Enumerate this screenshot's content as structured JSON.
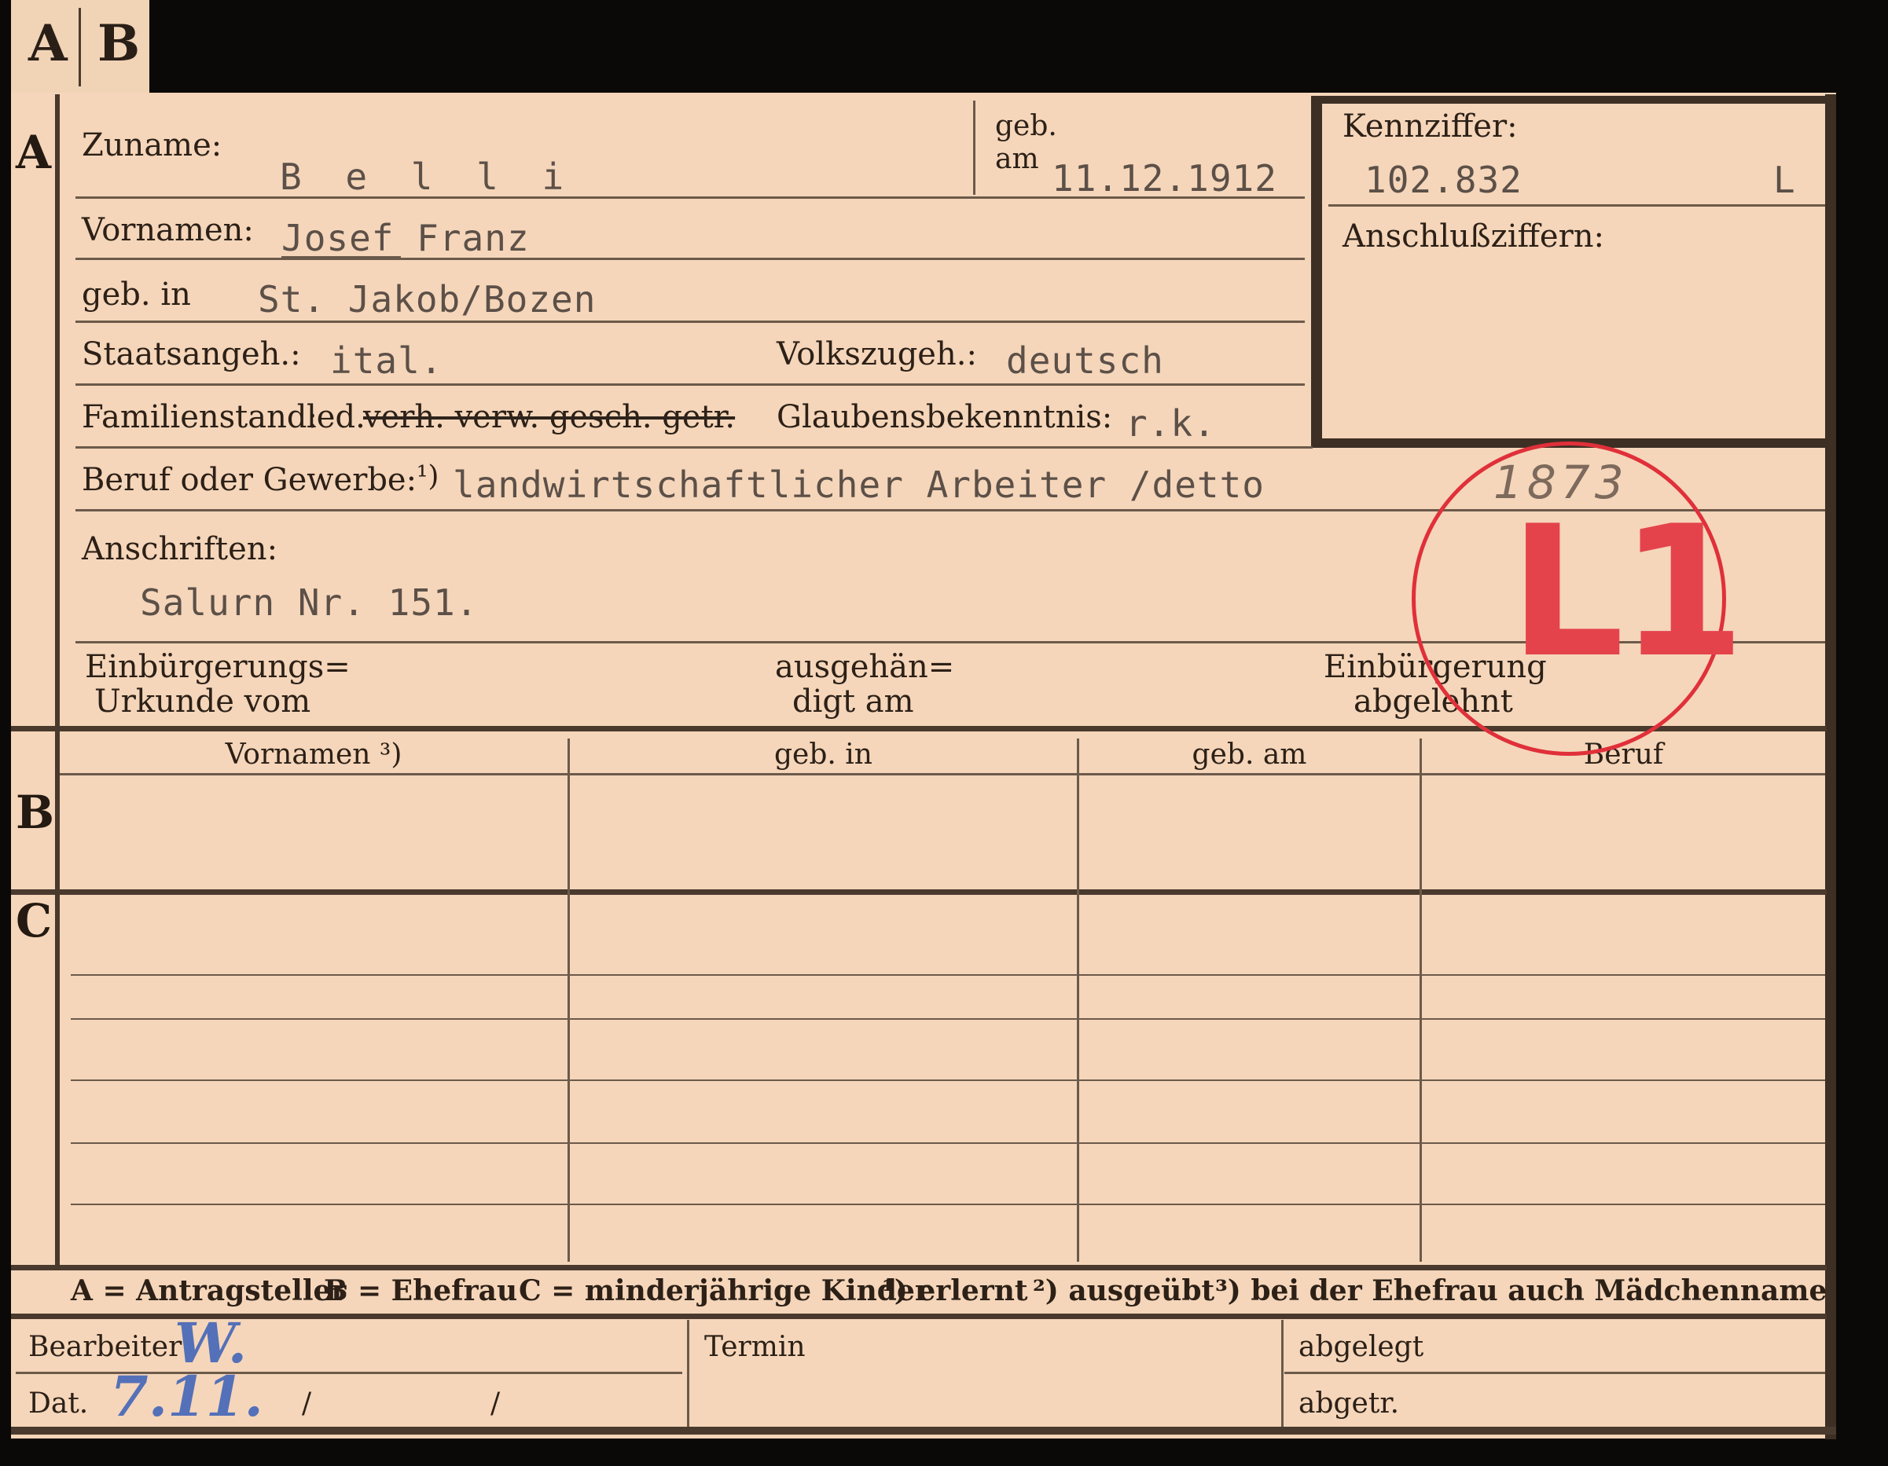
{
  "tab": {
    "letter_a": "A",
    "letter_b": "B"
  },
  "section_markers": {
    "a": "A",
    "b": "B",
    "c": "C"
  },
  "labels": {
    "zuname": "Zuname:",
    "geb_am_1": "geb.",
    "geb_am_2": "am",
    "kennziffer": "Kennziffer:",
    "anschlussziffern": "Anschlußziffern:",
    "vornamen": "Vornamen:",
    "geb_in": "geb. in",
    "staatsangeh": "Staatsangeh.:",
    "volkszugeh": "Volkszugeh.:",
    "familienstand": "Familienstand:",
    "familienstand_led": "led.",
    "familienstand_struck": "verh. verw. gesch. getr.",
    "glaubensbekenntnis": "Glaubensbekenntnis:",
    "beruf": "Beruf oder Gewerbe:",
    "beruf_note": "¹)",
    "anschriften": "Anschriften:",
    "einbuergerung_1": "Einbürgerungs=",
    "einbuergerung_2": "Urkunde vom",
    "ausgehaendigt_1": "ausgehän=",
    "ausgehaendigt_2": "digt am",
    "abgelehnt_1": "Einbürgerung",
    "abgelehnt_2": "abgelehnt"
  },
  "values": {
    "zuname": "B e l l i",
    "geb_am": "11.12.1912",
    "kennziffer": "102.832",
    "kennziffer_suffix": "L",
    "vornamen": "Josef Franz",
    "geb_in": "St. Jakob/Bozen",
    "staatsangeh": "ital.",
    "volkszugeh": "deutsch",
    "glaubensbekenntnis": "r.k.",
    "beruf": "landwirtschaftlicher Arbeiter /detto",
    "anschrift": "Salurn Nr. 151."
  },
  "table": {
    "columns": [
      "Vornamen ³)",
      "geb. in",
      "geb. am",
      "Beruf"
    ]
  },
  "legend": {
    "a": "A = Antragsteller",
    "b": "B = Ehefrau",
    "c": "C = minderjährige Kinder",
    "n1": "¹) erlernt",
    "n2": "²) ausgeübt",
    "n3": "³) bei der Ehefrau auch Mädchenname"
  },
  "footer": {
    "bearbeiter": "Bearbeiter:",
    "dat": "Dat.",
    "termin": "Termin",
    "abgelegt": "abgelegt",
    "abgetr": "abgetr.",
    "slash1": "/",
    "slash2": "/"
  },
  "handwriting": {
    "signature": "W.",
    "date": "7.11."
  },
  "stamp": {
    "code": "L1",
    "number": "1873"
  },
  "colors": {
    "card": "#f5d6ba",
    "ink": "#2c2017",
    "typewriter": "#5c5048",
    "stamp": "#e0303a",
    "pen": "#5470b8"
  }
}
